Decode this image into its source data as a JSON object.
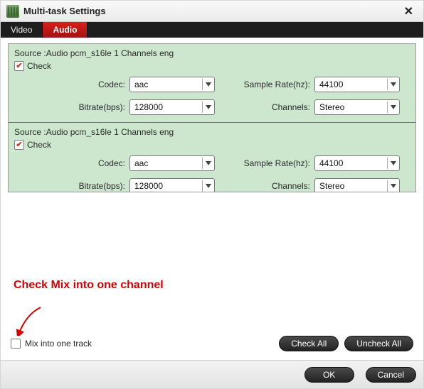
{
  "window": {
    "title": "Multi-task Settings"
  },
  "tabs": {
    "video": "Video",
    "audio": "Audio"
  },
  "sources": [
    {
      "label": "Source :Audio  pcm_s16le  1 Channels  eng",
      "check_label": "Check",
      "fields": {
        "codec_label": "Codec:",
        "codec_value": "aac",
        "bitrate_label": "Bitrate(bps):",
        "bitrate_value": "128000",
        "samplerate_label": "Sample Rate(hz):",
        "samplerate_value": "44100",
        "channels_label": "Channels:",
        "channels_value": "Stereo"
      }
    },
    {
      "label": "Source :Audio  pcm_s16le  1 Channels  eng",
      "check_label": "Check",
      "fields": {
        "codec_label": "Codec:",
        "codec_value": "aac",
        "bitrate_label": "Bitrate(bps):",
        "bitrate_value": "128000",
        "samplerate_label": "Sample Rate(hz):",
        "samplerate_value": "44100",
        "channels_label": "Channels:",
        "channels_value": "Stereo"
      }
    }
  ],
  "annotation": {
    "text": "Check Mix into one channel"
  },
  "mix": {
    "label": "Mix into one track"
  },
  "buttons": {
    "check_all": "Check All",
    "uncheck_all": "Uncheck All",
    "ok": "OK",
    "cancel": "Cancel"
  }
}
